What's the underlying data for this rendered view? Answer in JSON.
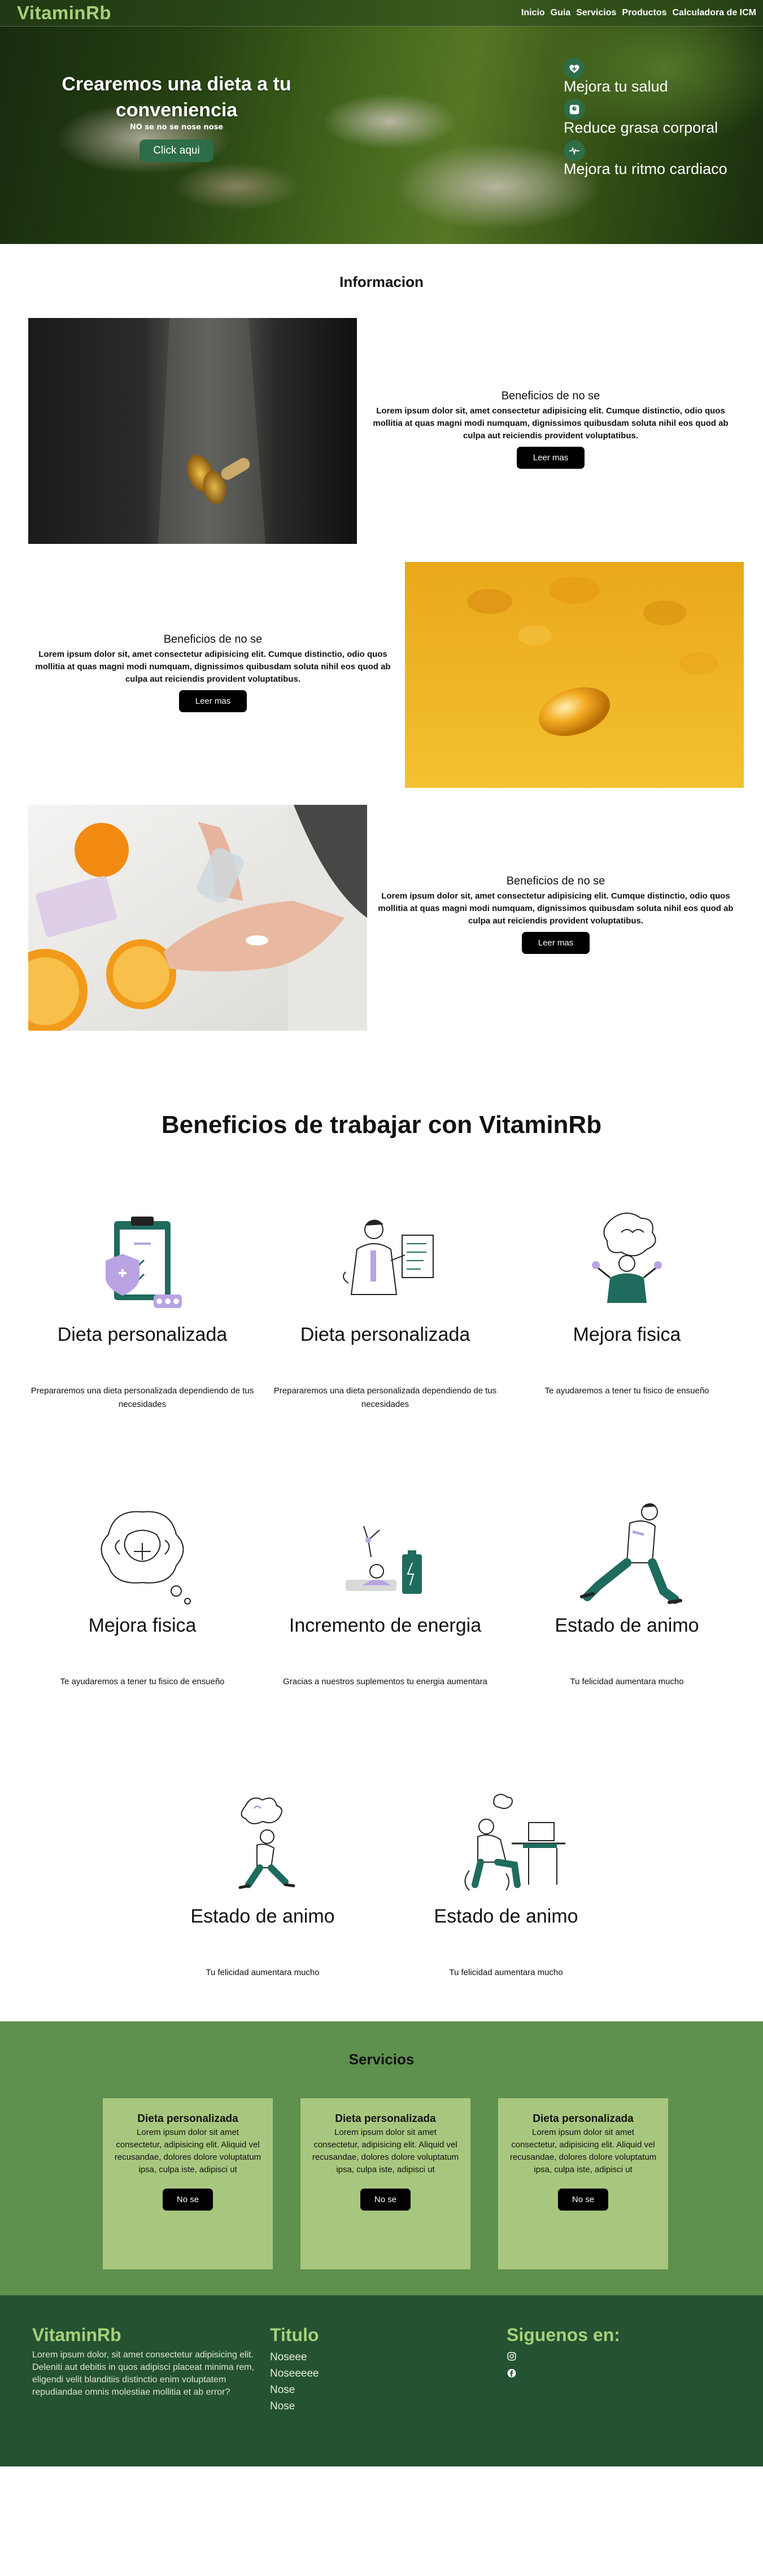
{
  "brand": "VitaminRb",
  "nav": [
    "Inicio",
    "Guia",
    "Servicios",
    "Productos",
    "Calculadora de ICM"
  ],
  "hero": {
    "title": "Crearemos una dieta a tu conveniencia",
    "subtitle": "NO se no se nose nose",
    "button": "Click aqui",
    "features": [
      {
        "icon": "heart-icon",
        "label": "Mejora tu salud"
      },
      {
        "icon": "scale-icon",
        "label": "Reduce grasa corporal"
      },
      {
        "icon": "heartbeat-icon",
        "label": "Mejora tu ritmo cardiaco"
      }
    ]
  },
  "info": {
    "title": "Informacion",
    "items": [
      {
        "heading": "Beneficios de no se",
        "body": "Lorem ipsum dolor sit, amet consectetur adipisicing elit. Cumque distinctio, odio quos mollitia at quas magni modi numquam, dignissimos quibusdam soluta nihil eos quod ab culpa aut reiciendis provident voluptatibus.",
        "button": "Leer mas"
      },
      {
        "heading": "Beneficios de no se",
        "body": "Lorem ipsum dolor sit, amet consectetur adipisicing elit. Cumque distinctio, odio quos mollitia at quas magni modi numquam, dignissimos quibusdam soluta nihil eos quod ab culpa aut reiciendis provident voluptatibus.",
        "button": "Leer mas"
      },
      {
        "heading": "Beneficios de no se",
        "body": "Lorem ipsum dolor sit, amet consectetur adipisicing elit. Cumque distinctio, odio quos mollitia at quas magni modi numquam, dignissimos quibusdam soluta nihil eos quod ab culpa aut reiciendis provident voluptatibus.",
        "button": "Leer mas"
      }
    ]
  },
  "benefits": {
    "title": "Beneficios de trabajar con VitaminRb",
    "cards": [
      {
        "title": "Dieta personalizada",
        "text": "Prepararemos una dieta personalizada dependiendo de tus necesidades"
      },
      {
        "title": "Dieta personalizada",
        "text": "Prepararemos una dieta personalizada dependiendo de tus necesidades"
      },
      {
        "title": "Mejora fisica",
        "text": "Te ayudaremos a tener tu fisico de ensueño"
      },
      {
        "title": "Mejora fisica",
        "text": "Te ayudaremos a tener tu fisico de ensueño"
      },
      {
        "title": "Incremento de energia",
        "text": "Gracias a nuestros suplementos tu energia aumentara"
      },
      {
        "title": "Estado de animo",
        "text": "Tu felicidad aumentara mucho"
      },
      {
        "title": "Estado de animo",
        "text": "Tu felicidad aumentara mucho"
      },
      {
        "title": "Estado de animo",
        "text": "Tu felicidad aumentara mucho"
      }
    ]
  },
  "services": {
    "title": "Servicios",
    "cards": [
      {
        "title": "Dieta personalizada",
        "body": "Lorem ipsum dolor sit amet consectetur, adipisicing elit. Aliquid vel recusandae, dolores dolore voluptatum ipsa, culpa iste, adipisci ut",
        "button": "No se"
      },
      {
        "title": "Dieta personalizada",
        "body": "Lorem ipsum dolor sit amet consectetur, adipisicing elit. Aliquid vel recusandae, dolores dolore voluptatum ipsa, culpa iste, adipisci ut",
        "button": "No se"
      },
      {
        "title": "Dieta personalizada",
        "body": "Lorem ipsum dolor sit amet consectetur, adipisicing elit. Aliquid vel recusandae, dolores dolore voluptatum ipsa, culpa iste, adipisci ut",
        "button": "No se"
      }
    ]
  },
  "footer": {
    "brand": "VitaminRb",
    "about": "Lorem ipsum dolor, sit amet consectetur adipisicing elit. Deleniti aut debitis in quos adipisci placeat minima rem, eligendi velit blanditiis distinctio enim voluptatem repudiandae omnis molestiae mollitia et ab error?",
    "links_title": "Titulo",
    "links": [
      "Noseee",
      "Noseeeee",
      "Nose",
      "Nose"
    ],
    "social_title": "Siguenos en:",
    "social_icons": [
      "instagram-icon",
      "facebook-icon"
    ]
  },
  "colors": {
    "brand_green": "#a7d07a",
    "button_green": "#2d6d47",
    "services_bg": "#5e904e",
    "card_bg": "#a8c77e",
    "footer_bg": "#245232",
    "illustration_accent": "#1f6b5e",
    "illustration_purple": "#b9a3e3"
  }
}
